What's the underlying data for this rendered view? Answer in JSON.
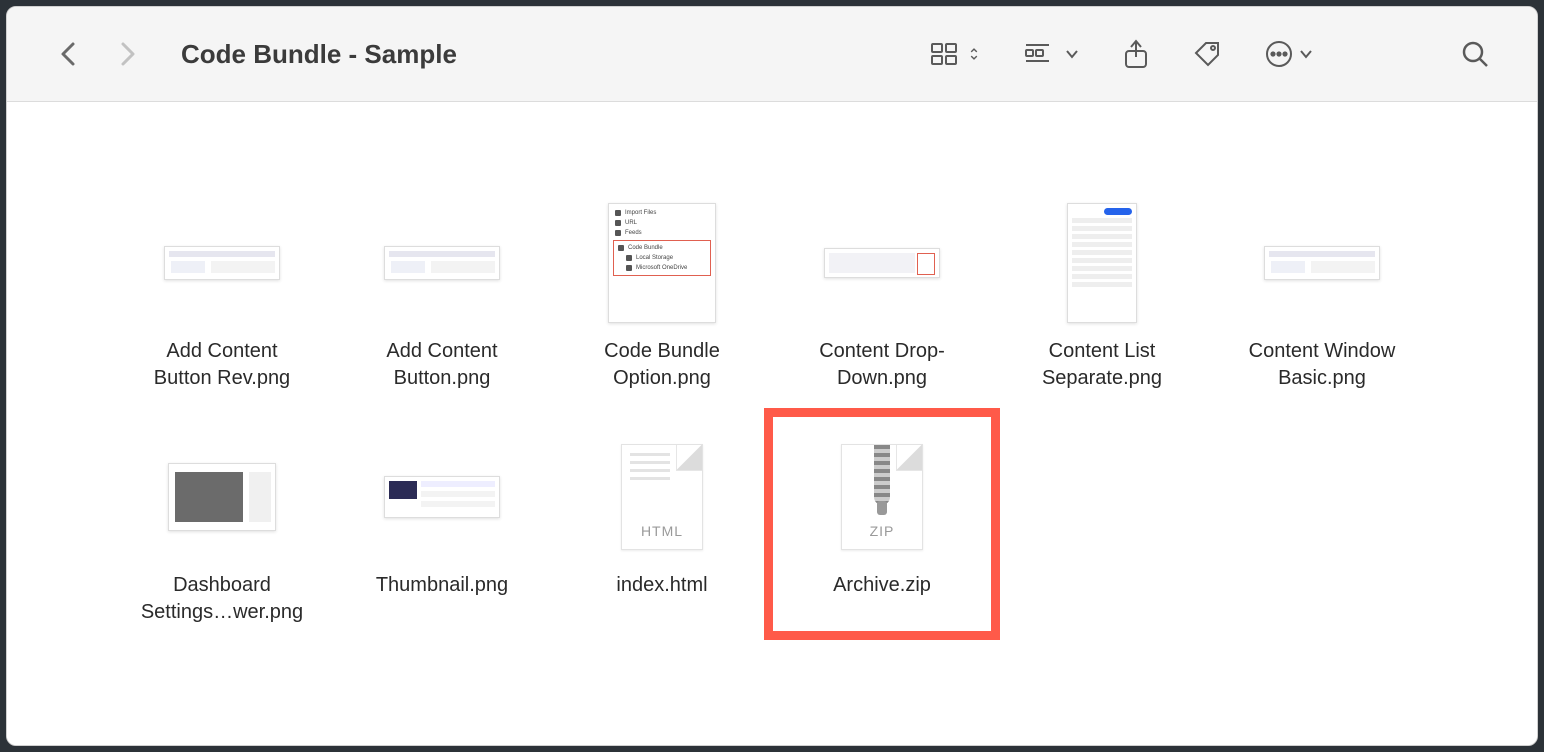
{
  "window": {
    "title": "Code Bundle - Sample"
  },
  "files": [
    {
      "name": "Add Content\nButton Rev.png",
      "kind": "shot-wide"
    },
    {
      "name": "Add Content\nButton.png",
      "kind": "shot-wide"
    },
    {
      "name": "Code Bundle\nOption.png",
      "kind": "shot-menu"
    },
    {
      "name": "Content Drop-\nDown.png",
      "kind": "shot-dd"
    },
    {
      "name": "Content List\nSeparate.png",
      "kind": "shot-list"
    },
    {
      "name": "Content Window\nBasic.png",
      "kind": "shot-wide"
    },
    {
      "name": "Dashboard\nSettings…wer.png",
      "kind": "shot-dash"
    },
    {
      "name": "Thumbnail.png",
      "kind": "shot-thumb2"
    },
    {
      "name": "index.html",
      "kind": "doc-html",
      "tag": "HTML"
    },
    {
      "name": "Archive.zip",
      "kind": "doc-zip",
      "tag": "ZIP",
      "highlighted": true
    }
  ],
  "menu_thumb": {
    "rows": [
      "Import Files",
      "URL",
      "Feeds"
    ],
    "hl_title": "Code Bundle",
    "hl_rows": [
      "Local Storage",
      "Microsoft OneDrive"
    ]
  }
}
